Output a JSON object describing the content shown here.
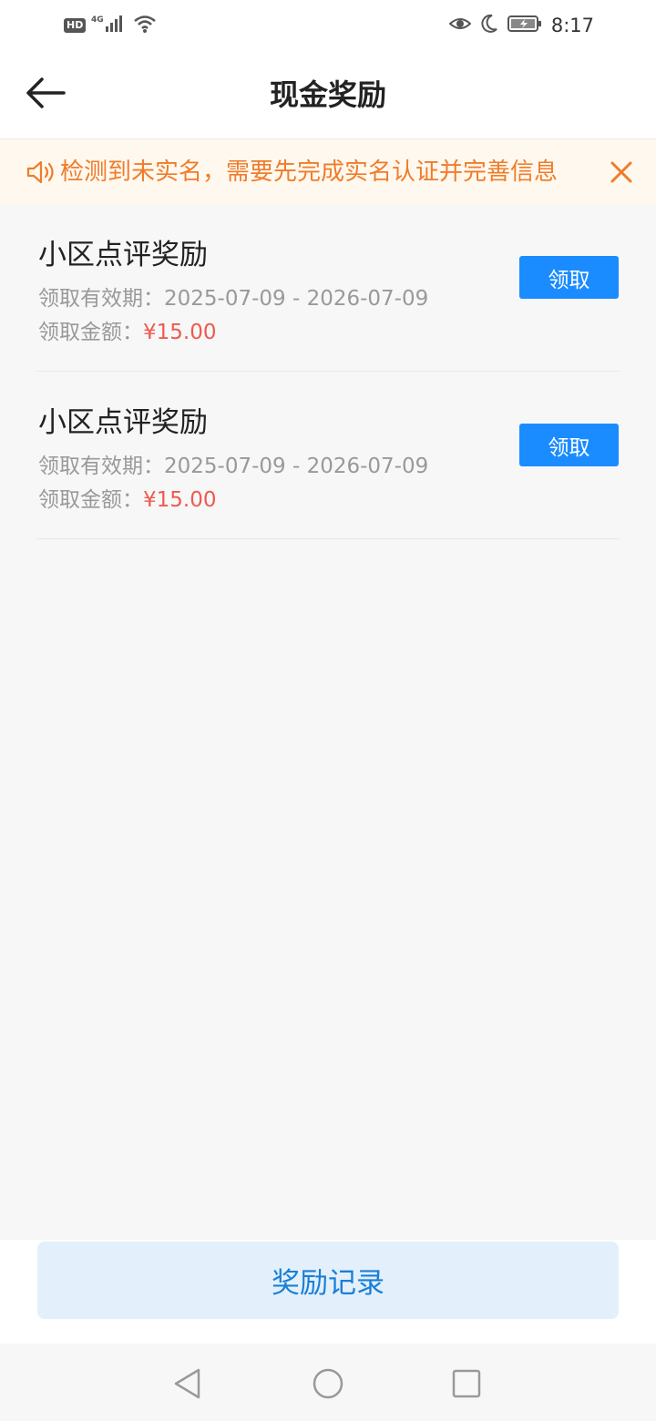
{
  "status_bar": {
    "hd_label": "HD",
    "network_label": "4G",
    "time": "8:17"
  },
  "header": {
    "title": "现金奖励",
    "back_icon": "arrow-left-icon"
  },
  "notice": {
    "text": "检测到未实名，需要先完成实名认证并完善信息",
    "icon": "speaker-icon",
    "close_icon": "close-icon",
    "color": "#f07c2a"
  },
  "rewards": [
    {
      "title": "小区点评奖励",
      "period_label": "领取有效期：",
      "period": "2025-07-09 - 2026-07-09",
      "amount_label": "领取金额：",
      "amount": "¥15.00",
      "button": "领取"
    },
    {
      "title": "小区点评奖励",
      "period_label": "领取有效期：",
      "period": "2025-07-09 - 2026-07-09",
      "amount_label": "领取金额：",
      "amount": "¥15.00",
      "button": "领取"
    }
  ],
  "footer": {
    "record_button": "奖励记录"
  },
  "colors": {
    "accent": "#1a8cff",
    "amount": "#ee5a50",
    "notice_bg": "#fff8ee"
  }
}
